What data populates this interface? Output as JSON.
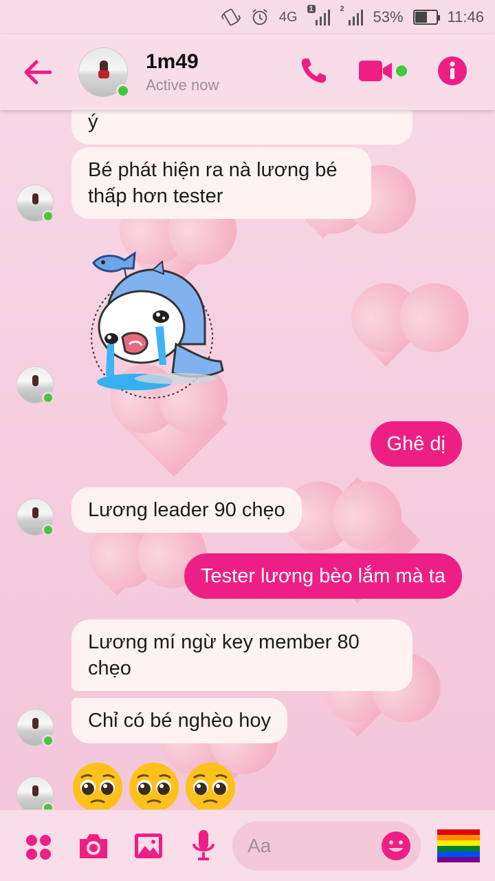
{
  "status_bar": {
    "network": "4G",
    "sim1_badge": "1",
    "sim2_badge": "2",
    "battery": "53%",
    "time": "11:46"
  },
  "header": {
    "name": "1m49",
    "status": "Active now"
  },
  "messages": {
    "m0": "ý",
    "m1": "Bé phát hiện ra nà lương bé thấp hơn tester",
    "m2": "Ghê dị",
    "m3": "Lương leader 90 chẹo",
    "m4": "Tester lương bèo lắm mà ta",
    "m5": "Lương mí ngừ key member 80 chẹo",
    "m6": "Chỉ có bé nghèo hoy"
  },
  "emojis": [
    "🥺",
    "🥺",
    "🥺"
  ],
  "composer": {
    "placeholder": "Aa",
    "quick_reaction": "🏳️‍🌈"
  },
  "colors": {
    "accent": "#ee1f84",
    "incoming_bubble": "#fff2f2",
    "online": "#42c83c"
  }
}
